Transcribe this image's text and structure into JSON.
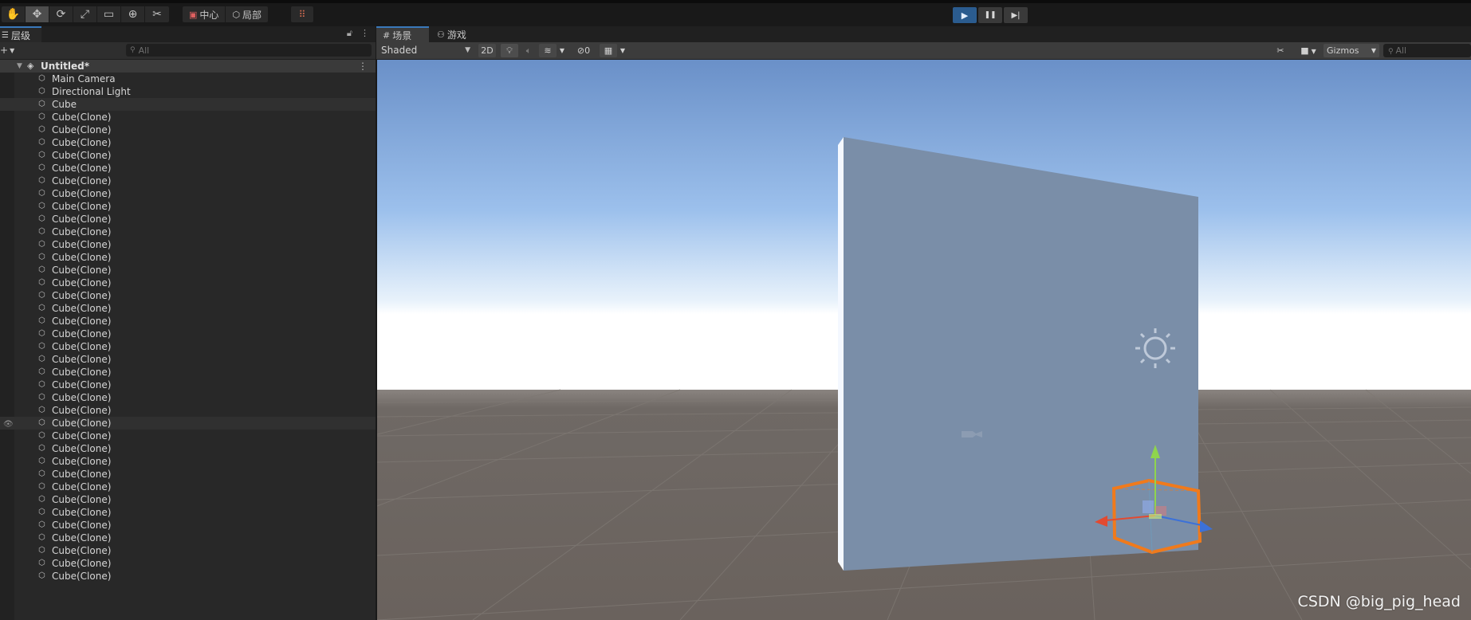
{
  "toolbar": {
    "tools": [
      {
        "name": "hand-tool-icon",
        "glyph": "✋"
      },
      {
        "name": "move-tool-icon",
        "glyph": "✥"
      },
      {
        "name": "rotate-tool-icon",
        "glyph": "⟳"
      },
      {
        "name": "scale-tool-icon",
        "glyph": "⤢"
      },
      {
        "name": "rect-tool-icon",
        "glyph": "▭"
      },
      {
        "name": "transform-tool-icon",
        "glyph": "⊕"
      },
      {
        "name": "custom-tool-icon",
        "glyph": "✂"
      }
    ],
    "pivot_label": "中心",
    "space_label": "局部",
    "play_glyph": "▶",
    "pause_glyph": "❚❚",
    "step_glyph": "▶|"
  },
  "hierarchy": {
    "tab_label": "层级",
    "search_placeholder": "All",
    "scene_name": "Untitled*",
    "items": [
      "Main Camera",
      "Directional Light",
      "Cube",
      "Cube(Clone)",
      "Cube(Clone)",
      "Cube(Clone)",
      "Cube(Clone)",
      "Cube(Clone)",
      "Cube(Clone)",
      "Cube(Clone)",
      "Cube(Clone)",
      "Cube(Clone)",
      "Cube(Clone)",
      "Cube(Clone)",
      "Cube(Clone)",
      "Cube(Clone)",
      "Cube(Clone)",
      "Cube(Clone)",
      "Cube(Clone)",
      "Cube(Clone)",
      "Cube(Clone)",
      "Cube(Clone)",
      "Cube(Clone)",
      "Cube(Clone)",
      "Cube(Clone)",
      "Cube(Clone)",
      "Cube(Clone)",
      "Cube(Clone)",
      "Cube(Clone)",
      "Cube(Clone)",
      "Cube(Clone)",
      "Cube(Clone)",
      "Cube(Clone)",
      "Cube(Clone)",
      "Cube(Clone)",
      "Cube(Clone)",
      "Cube(Clone)",
      "Cube(Clone)",
      "Cube(Clone)",
      "Cube(Clone)"
    ]
  },
  "scene": {
    "tab_scene": "场景",
    "tab_game": "游戏",
    "shading_mode": "Shaded",
    "mode_2d": "2D",
    "hidden_count": "0",
    "gizmos_label": "Gizmos",
    "search_placeholder": "All"
  },
  "watermark": "CSDN @big_pig_head"
}
